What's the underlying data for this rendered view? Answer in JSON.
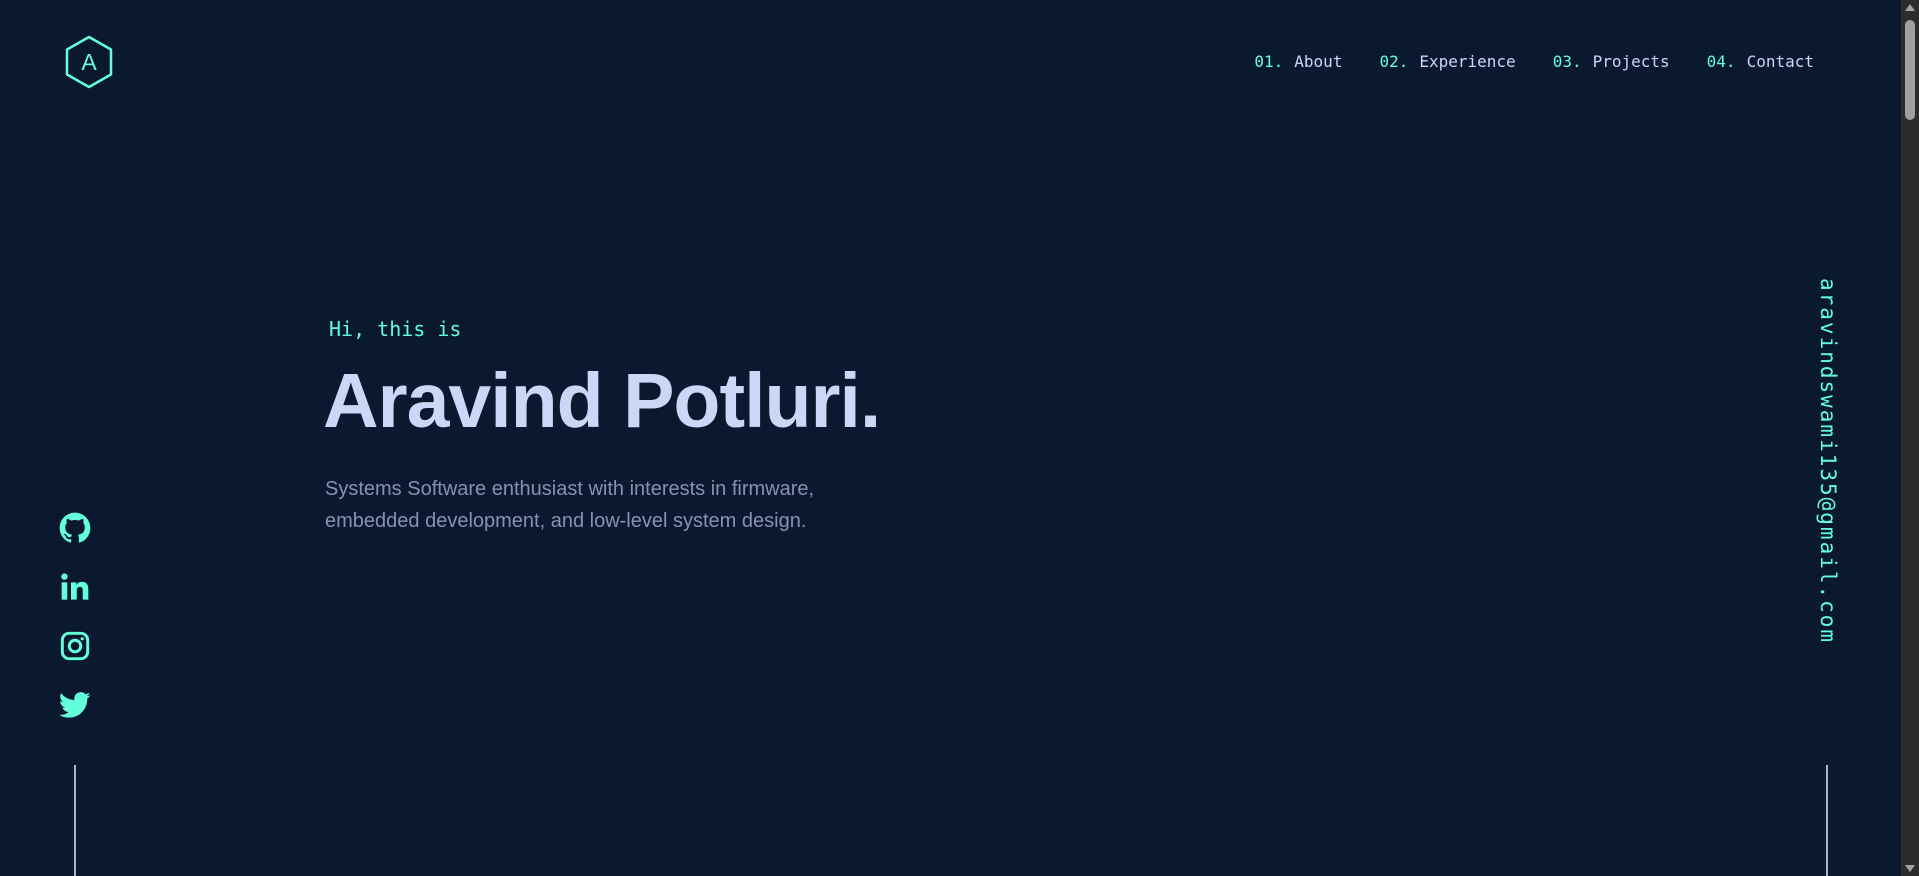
{
  "theme": {
    "background": "#0a192f",
    "accent": "#64ffda",
    "heading": "#ccd6f6",
    "text": "#8892b0",
    "line": "#a8b2d1"
  },
  "logo": {
    "letter": "A",
    "icon": "hexagon-logo-icon"
  },
  "nav": {
    "items": [
      {
        "num": "01.",
        "label": "About"
      },
      {
        "num": "02.",
        "label": "Experience"
      },
      {
        "num": "03.",
        "label": "Projects"
      },
      {
        "num": "04.",
        "label": "Contact"
      }
    ]
  },
  "hero": {
    "intro": "Hi, this is",
    "name": "Aravind Potluri.",
    "description": "Systems Software enthusiast with interests in firmware, embedded development, and low-level system design."
  },
  "social": [
    {
      "name": "GitHub",
      "icon": "github-icon"
    },
    {
      "name": "LinkedIn",
      "icon": "linkedin-icon"
    },
    {
      "name": "Instagram",
      "icon": "instagram-icon"
    },
    {
      "name": "Twitter",
      "icon": "twitter-icon"
    }
  ],
  "email": "aravindswami135@gmail.com"
}
